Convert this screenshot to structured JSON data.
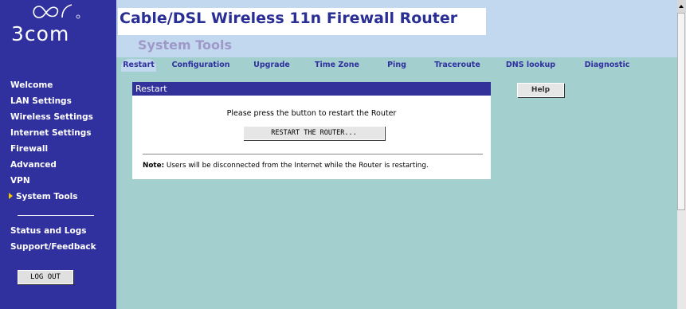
{
  "sidebar": {
    "logo_text": "3com",
    "items": [
      {
        "label": "Welcome"
      },
      {
        "label": "LAN Settings"
      },
      {
        "label": "Wireless Settings"
      },
      {
        "label": "Internet Settings"
      },
      {
        "label": "Firewall"
      },
      {
        "label": "Advanced"
      },
      {
        "label": "VPN"
      },
      {
        "label": "System Tools"
      }
    ],
    "bottom_items": [
      {
        "label": "Status and Logs"
      },
      {
        "label": "Support/Feedback"
      }
    ],
    "logout_label": "LOG OUT"
  },
  "header": {
    "app_title": "Cable/DSL Wireless 11n Firewall Router",
    "page_title": "System Tools"
  },
  "tabs": [
    {
      "label": "Restart",
      "active": true
    },
    {
      "label": "Configuration"
    },
    {
      "label": "Upgrade"
    },
    {
      "label": "Time Zone"
    },
    {
      "label": "Ping"
    },
    {
      "label": "Traceroute"
    },
    {
      "label": "DNS lookup"
    },
    {
      "label": "Diagnostic"
    }
  ],
  "panel": {
    "title": "Restart",
    "message": "Please press the button to restart the Router",
    "button_label": "RESTART THE ROUTER...",
    "note_label": "Note:",
    "note_text": " Users will be disconnected from the Internet while the Router is restarting."
  },
  "help_label": "Help",
  "colors": {
    "sidebar": "#30309e",
    "content": "#a3cfcf",
    "header_band": "#c2d8ee",
    "title_text": "#2a2f95",
    "panel_header": "#32329a",
    "active_arrow": "#f5c800"
  }
}
